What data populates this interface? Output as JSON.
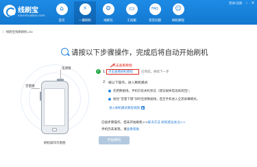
{
  "app": {
    "name": "线刷宝",
    "url": "xianshuabao.com"
  },
  "nav": {
    "items": [
      {
        "label": "首页",
        "icon": "home-icon"
      },
      {
        "label": "一键刷机",
        "icon": "flash-icon",
        "active": true
      },
      {
        "label": "线刷包",
        "icon": "package-icon"
      },
      {
        "label": "工具箱",
        "icon": "toolbox-icon"
      },
      {
        "label": "常见问题",
        "icon": "faq-icon"
      },
      {
        "label": "刷机教程",
        "icon": "tutorial-icon"
      }
    ]
  },
  "user": {
    "label": "登录/注册"
  },
  "breadcrumb": {
    "text": "线刷宝线刷刷机.zix"
  },
  "heading": {
    "text": "请按以下步骤操作，完成后将自动开始刷机"
  },
  "illustration": {
    "power_label": "电源键",
    "volume_label": "音量键",
    "home_label": "刷机操作示意图"
  },
  "steps": {
    "annotation": "点击查看教程",
    "step1": {
      "num": "1.",
      "button_label": "点击查看刷机教程",
      "status": "已完成，继续下一步"
    },
    "step2": {
      "num": "2.",
      "text": "按以下操作，进入刷机模式",
      "bullet1": "先把数据线，手机仍处关机状态（建议拔掉电池再装回）；",
      "bullet2": "按住“音量下键”同时连接数据线，直至手机进入全黑屏幕模式。",
      "link": "进入刷机模式教程视频"
    }
  },
  "notes": {
    "line1_prefix": "已按步骤操作，但未开始刷机>>",
    "line1_link1": "解决方法",
    "line1_link2": "刷机建议关注>>",
    "line2_prefix": "手机仍未发现，请",
    "line2_link": "查看帮助"
  },
  "start_button": {
    "label": "开始刷机"
  },
  "colors": {
    "topbar": "#1378cf",
    "accent": "#2a8ae4",
    "alert": "#e0231a",
    "success": "#27a844"
  }
}
